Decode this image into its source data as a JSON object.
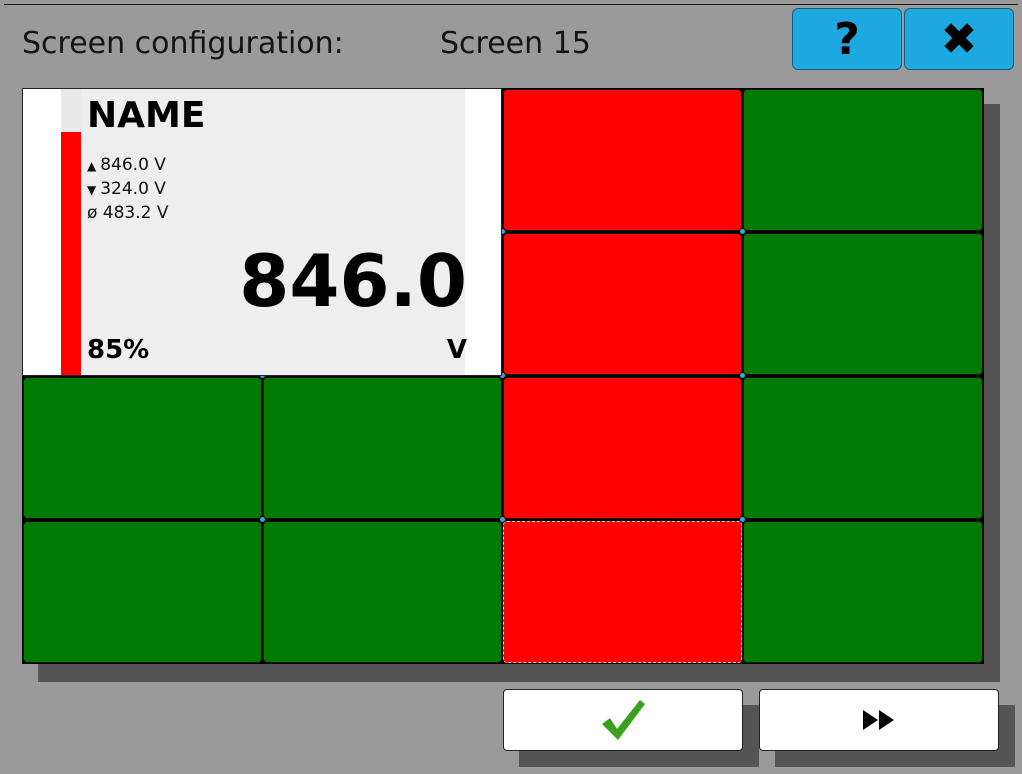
{
  "header": {
    "title": "Screen configuration:",
    "screen_name": "Screen 15",
    "help_label": "?",
    "close_label": "✖"
  },
  "widget": {
    "name": "NAME",
    "max_text": "846.0 V",
    "min_text": "324.0 V",
    "avg_text": "ø 483.2 V",
    "value": "846.0",
    "unit": "V",
    "percent": "85%",
    "fill_fraction": 0.85,
    "bar_color": "#ff0000"
  },
  "grid": {
    "colors": {
      "green": "#007a00",
      "red": "#ff0000"
    },
    "cells": [
      [
        "widget",
        "widget",
        "red",
        "green"
      ],
      [
        "widget",
        "widget",
        "red",
        "green"
      ],
      [
        "green",
        "green",
        "red",
        "green"
      ],
      [
        "green",
        "green",
        "red-selected",
        "green"
      ]
    ]
  },
  "footer": {
    "confirm_icon": "check-icon",
    "next_icon": "fast-forward-icon",
    "confirm_color": "#3aa11b"
  }
}
